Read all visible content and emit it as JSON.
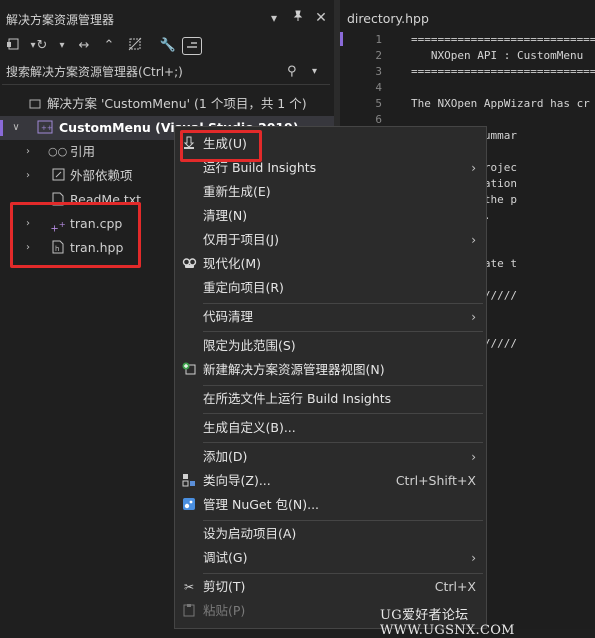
{
  "solution_explorer": {
    "title": "解决方案资源管理器",
    "title_icons": [
      "chevron-down-icon",
      "pin-icon",
      "close-icon"
    ],
    "search": {
      "placeholder": "搜索解决方案资源管理器(Ctrl+;)"
    },
    "tree": {
      "solution": "解决方案 'CustomMenu' (1 个项目，共 1 个)",
      "project": "CustomMenu (Visual Studio 2019)",
      "items": [
        {
          "label": "引用",
          "icon": "references-icon"
        },
        {
          "label": "外部依赖项",
          "icon": "external-deps-icon"
        },
        {
          "label": "ReadMe.txt",
          "icon": "text-file-icon"
        },
        {
          "label": "tran.cpp",
          "icon": "cpp-file-icon"
        },
        {
          "label": "tran.hpp",
          "icon": "header-file-icon"
        }
      ]
    }
  },
  "editor": {
    "tab": "directory.hpp",
    "lines": [
      {
        "n": "1",
        "text": "=============================="
      },
      {
        "n": "2",
        "text": "   NXOpen API : CustomMenu"
      },
      {
        "n": "3",
        "text": "=============================="
      },
      {
        "n": "4",
        "text": ""
      },
      {
        "n": "5",
        "text": "The NXOpen AppWizard has cr"
      },
      {
        "n": "6",
        "text": ""
      },
      {
        "n": "7",
        "text": "ontains a summar"
      },
      {
        "n": "8",
        "text": ""
      },
      {
        "n": "9",
        "text": " the main projec"
      },
      {
        "n": "10",
        "text": "ains information"
      },
      {
        "n": "11",
        "text": "tion about the p"
      },
      {
        "n": "12",
        "text": "tion Wizard."
      },
      {
        "n": "13",
        "text": ""
      },
      {
        "n": "14",
        "text": ""
      },
      {
        "n": "15",
        "text": "ample template t"
      },
      {
        "n": "16",
        "text": ""
      },
      {
        "n": "17",
        "text": "////////////////"
      },
      {
        "n": "18",
        "text": ":"
      },
      {
        "n": "19",
        "text": ""
      },
      {
        "n": "20",
        "text": "////////////////"
      }
    ]
  },
  "context_menu": {
    "items": [
      {
        "label": "生成(U)",
        "icon": "build-icon"
      },
      {
        "label": "运行 Build Insights",
        "submenu": true
      },
      {
        "label": "重新生成(E)"
      },
      {
        "label": "清理(N)"
      },
      {
        "label": "仅用于项目(J)",
        "submenu": true
      },
      {
        "label": "现代化(M)",
        "icon": "copilot-icon"
      },
      {
        "label": "重定向项目(R)"
      },
      {
        "label": "代码清理",
        "submenu": true
      },
      {
        "label": "限定为此范围(S)"
      },
      {
        "label": "新建解决方案资源管理器视图(N)",
        "icon": "new-view-icon"
      },
      {
        "label": "在所选文件上运行 Build Insights"
      },
      {
        "label": "生成自定义(B)..."
      },
      {
        "label": "添加(D)",
        "submenu": true
      },
      {
        "label": "类向导(Z)...",
        "icon": "class-wizard-icon",
        "shortcut": "Ctrl+Shift+X"
      },
      {
        "label": "管理 NuGet 包(N)...",
        "icon": "nuget-icon"
      },
      {
        "label": "设为启动项目(A)"
      },
      {
        "label": "调试(G)",
        "submenu": true
      },
      {
        "label": "剪切(T)",
        "icon": "scissors-icon",
        "shortcut": "Ctrl+X"
      },
      {
        "label": "粘贴(P)",
        "icon": "paste-icon",
        "disabled": true
      }
    ]
  },
  "watermark": "UG爱好者论坛 WWW.UGSNX.COM",
  "colors": {
    "accent": "#8a6ad8",
    "highlight_box": "#e22a2a",
    "background": "#1f1f1f",
    "menu_bg": "#2b2b2b"
  }
}
